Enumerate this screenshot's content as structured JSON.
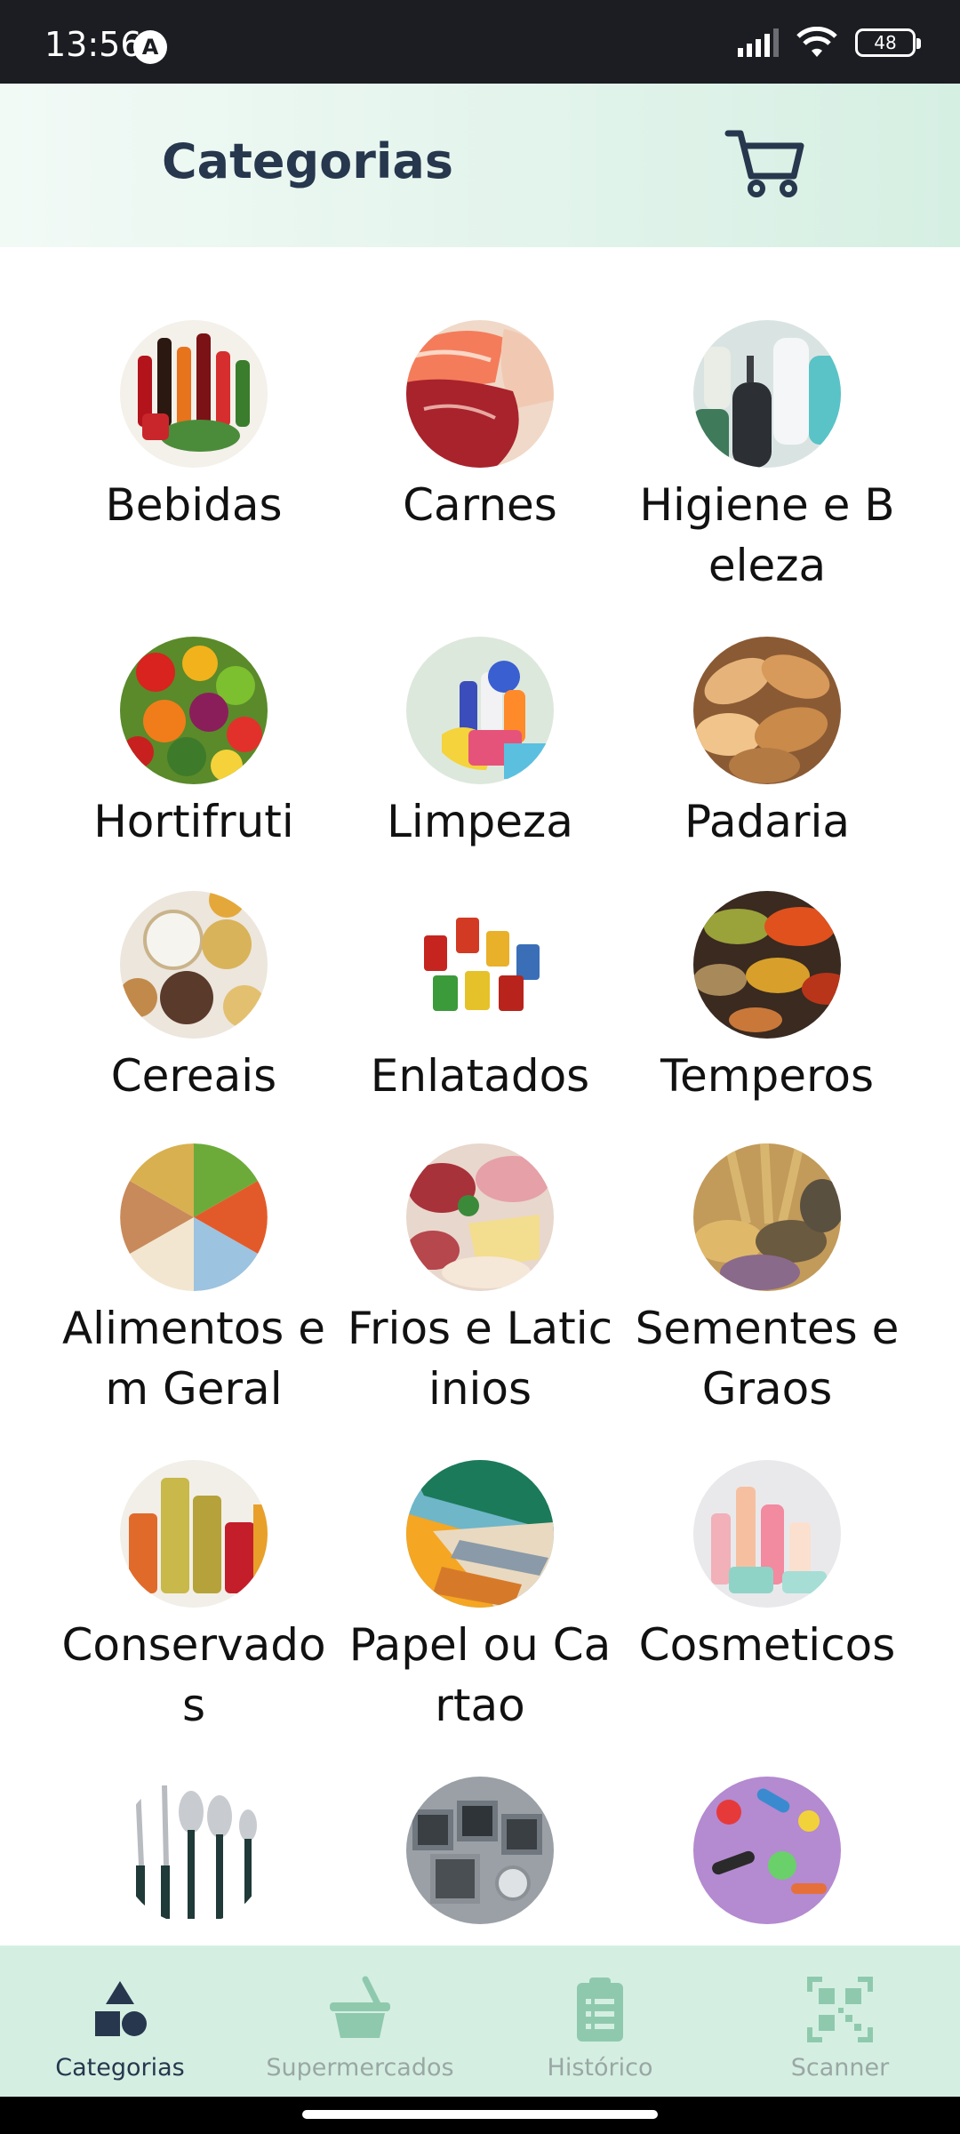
{
  "status_bar": {
    "time": "13:56",
    "notification_badge": "A",
    "battery_level": "48"
  },
  "header": {
    "title": "Categorias",
    "cart_icon": "shopping-cart-icon"
  },
  "categories": [
    {
      "label": "Bebidas",
      "icon": "beverages-image"
    },
    {
      "label": "Carnes",
      "icon": "meat-image"
    },
    {
      "label": "Higiene e Beleza",
      "icon": "hygiene-image"
    },
    {
      "label": "Hortifruti",
      "icon": "produce-image"
    },
    {
      "label": "Limpeza",
      "icon": "cleaning-image"
    },
    {
      "label": "Padaria",
      "icon": "bakery-image"
    },
    {
      "label": "Cereais",
      "icon": "cereals-image"
    },
    {
      "label": "Enlatados",
      "icon": "canned-image"
    },
    {
      "label": "Temperos",
      "icon": "spices-image"
    },
    {
      "label": "Alimentos em Geral",
      "icon": "general-food-image"
    },
    {
      "label": "Frios e Laticinios",
      "icon": "dairy-image"
    },
    {
      "label": "Sementes e Graos",
      "icon": "seeds-image"
    },
    {
      "label": "Conservados",
      "icon": "preserves-image"
    },
    {
      "label": "Papel ou Cartao",
      "icon": "paper-image"
    },
    {
      "label": "Cosmeticos",
      "icon": "cosmetics-image"
    },
    {
      "label": "",
      "icon": "cutlery-image"
    },
    {
      "label": "",
      "icon": "metal-image"
    },
    {
      "label": "",
      "icon": "pet-toys-image"
    }
  ],
  "bottom_nav": {
    "items": [
      {
        "label": "Categorias",
        "icon": "shapes-icon",
        "active": true
      },
      {
        "label": "Supermercados",
        "icon": "basket-icon",
        "active": false
      },
      {
        "label": "Histórico",
        "icon": "clipboard-icon",
        "active": false
      },
      {
        "label": "Scanner",
        "icon": "qr-code-icon",
        "active": false
      }
    ]
  },
  "colors": {
    "title": "#27374d",
    "nav_background": "#d4efe2",
    "nav_active": "#27374d",
    "nav_inactive": "#9aa7a4",
    "icon_green_inactive": "#8fc9ad"
  }
}
